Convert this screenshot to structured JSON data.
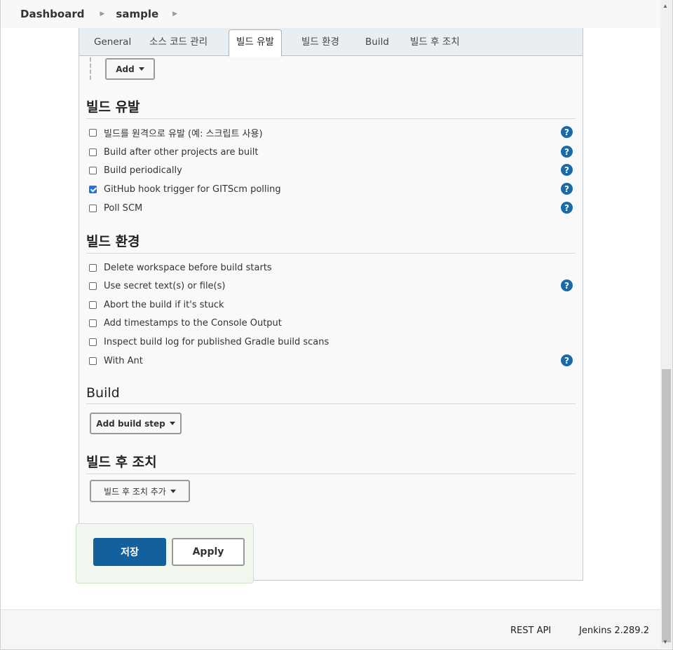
{
  "breadcrumb": {
    "items": [
      "Dashboard",
      "sample"
    ]
  },
  "tabs": [
    "General",
    "소스 코드 관리",
    "빌드 유발",
    "빌드 환경",
    "Build",
    "빌드 후 조치"
  ],
  "active_tab": "빌드 유발",
  "add_button": {
    "label": "Add"
  },
  "triggers": {
    "title": "빌드 유발",
    "options": [
      {
        "label": "빌드를 원격으로 유발 (예: 스크립트 사용)",
        "checked": false,
        "help": true
      },
      {
        "label": "Build after other projects are built",
        "checked": false,
        "help": true
      },
      {
        "label": "Build periodically",
        "checked": false,
        "help": true
      },
      {
        "label": "GitHub hook trigger for GITScm polling",
        "checked": true,
        "help": true
      },
      {
        "label": "Poll SCM",
        "checked": false,
        "help": true
      }
    ]
  },
  "environment": {
    "title": "빌드 환경",
    "options": [
      {
        "label": "Delete workspace before build starts",
        "checked": false,
        "help": false
      },
      {
        "label": "Use secret text(s) or file(s)",
        "checked": false,
        "help": true
      },
      {
        "label": "Abort the build if it's stuck",
        "checked": false,
        "help": false
      },
      {
        "label": "Add timestamps to the Console Output",
        "checked": false,
        "help": false
      },
      {
        "label": "Inspect build log for published Gradle build scans",
        "checked": false,
        "help": false
      },
      {
        "label": "With Ant",
        "checked": false,
        "help": true
      }
    ]
  },
  "build": {
    "title": "Build",
    "add_step_label": "Add build step"
  },
  "post_build": {
    "title": "빌드 후 조치",
    "add_label": "빌드 후 조치 추가"
  },
  "actions": {
    "save_label": "저장",
    "apply_label": "Apply"
  },
  "footer": {
    "rest_api": "REST API",
    "version": "Jenkins 2.289.2"
  },
  "icons": {
    "help": "help-icon",
    "checkbox": "checkbox",
    "caret": "caret-down-icon"
  },
  "colors": {
    "primary": "#13609c",
    "help": "#1a6aa8",
    "checkbox_checked": "#1a73e8",
    "save_area": "#f1f7ee"
  }
}
